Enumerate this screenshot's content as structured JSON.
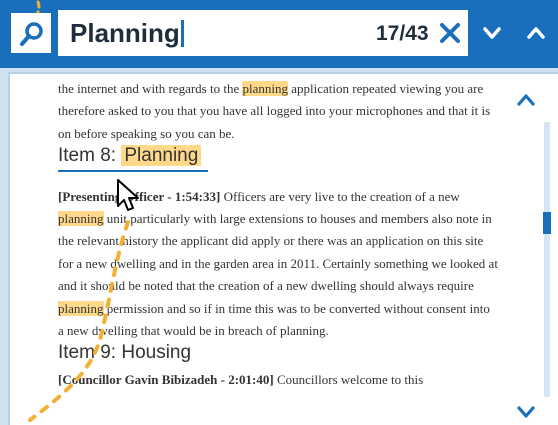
{
  "search": {
    "query": "Planning",
    "match_count": "17/43",
    "icons": {
      "search": "search-icon",
      "clear": "close-icon",
      "next": "chevron-down-icon",
      "prev": "chevron-up-icon"
    }
  },
  "document": {
    "intro": {
      "pre": "the internet and with regards to the ",
      "hl": "planning",
      "post": " application repeated viewing you are therefore asked to you that you have all logged into your microphones and that it is on before speaking so you can be."
    },
    "item8": {
      "prefix": "Item 8: ",
      "title_hl": "Planning",
      "speaker": "[Presenting Officer - 1:54:33]",
      "text1": " Officers are very live to the creation of a new ",
      "hl1": "planning",
      "text2": " unit particularly with large extensions to houses and members also note in the relevant history the applicant did apply or there was an application on this site for a new dwelling and in the garden area in 2011. Certainly something we looked at and it should be noted that the creation of a new dwelling should always require ",
      "hl2": "planning",
      "text3": " permission and so if in time this was to be converted without consent into a new dwelling that would be in breach of planning."
    },
    "item9": {
      "title": "Item 9: Housing",
      "speaker": "[Councillor Gavin Bibizadeh - 2:01:40]",
      "text": " Councillors welcome to this"
    }
  },
  "colors": {
    "accent": "#1a6fbd",
    "highlight": "#ffd88a",
    "trail": "#f2b134"
  }
}
